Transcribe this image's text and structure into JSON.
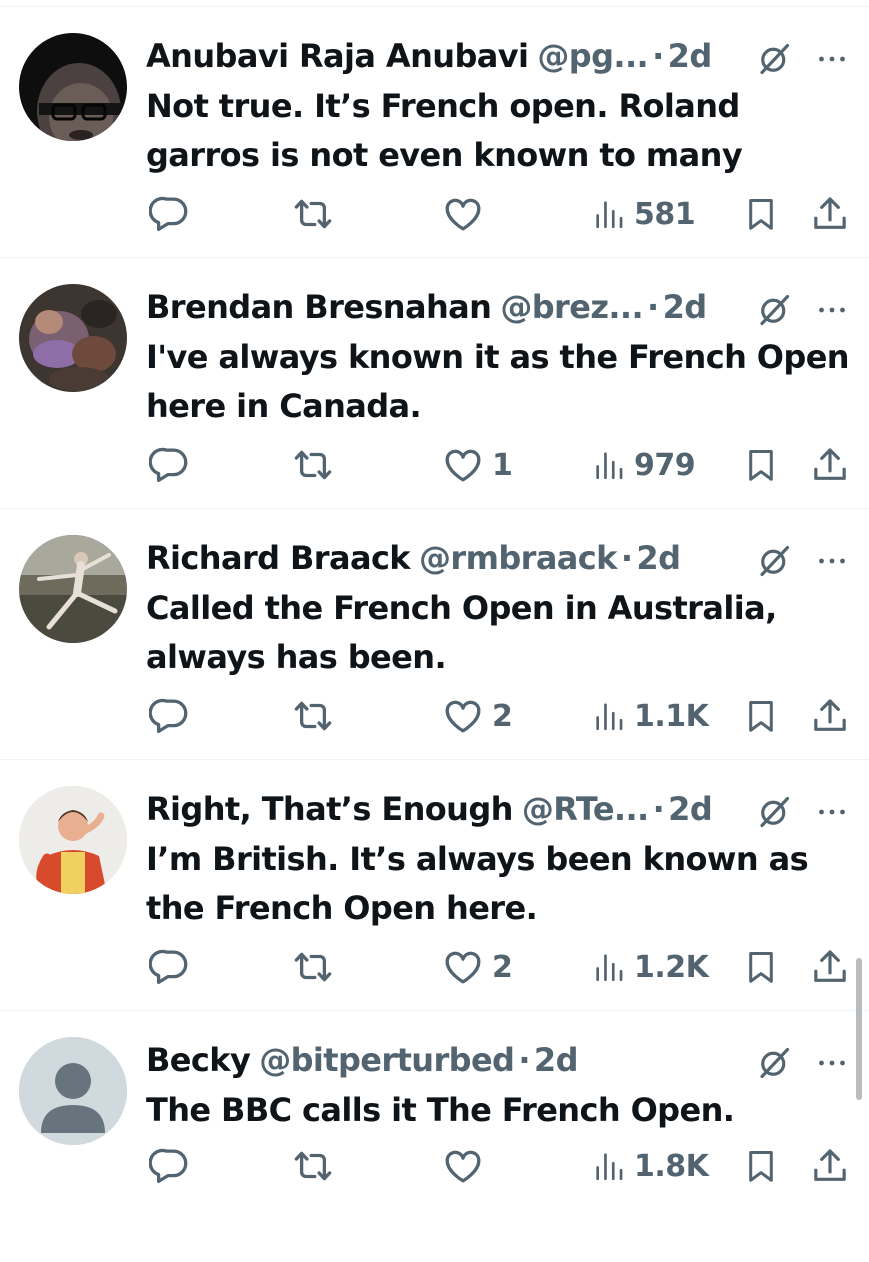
{
  "colors": {
    "text_primary": "#0f1419",
    "text_secondary": "#536471",
    "divider": "#eff3f4",
    "background": "#ffffff"
  },
  "icons": {
    "reply": "reply-icon",
    "retweet": "retweet-icon",
    "like": "heart-icon",
    "views": "views-icon",
    "bookmark": "bookmark-icon",
    "share": "share-icon",
    "grok": "grok-icon",
    "more": "more-icon"
  },
  "tweets": [
    {
      "display_name": "Anubavi Raja Anubavi",
      "handle": "@pg...",
      "separator": "·",
      "time": "2d",
      "text": "Not true. It’s French open. Roland garros is not even known to many",
      "reply_count": "",
      "retweet_count": "",
      "like_count": "",
      "views": "581",
      "avatar": "man-with-glasses-photo"
    },
    {
      "display_name": "Brendan Bresnahan",
      "handle": "@brez...",
      "separator": "·",
      "time": "2d",
      "text": "I've always known it as the French Open here in Canada.",
      "reply_count": "",
      "retweet_count": "",
      "like_count": "1",
      "views": "979",
      "avatar": "blurred-painting"
    },
    {
      "display_name": "Richard Braack",
      "handle": "@rmbraack",
      "separator": "·",
      "time": "2d",
      "text": "Called the French Open in Australia, always has been.",
      "reply_count": "",
      "retweet_count": "",
      "like_count": "2",
      "views": "1.1K",
      "avatar": "dancer-painting"
    },
    {
      "display_name": "Right, That’s Enough",
      "handle": "@RTe...",
      "separator": "·",
      "time": "2d",
      "text": "I’m British. It’s always been known as the French Open here.",
      "reply_count": "",
      "retweet_count": "",
      "like_count": "2",
      "views": "1.2K",
      "avatar": "man-red-shirt-illustration"
    },
    {
      "display_name": "Becky",
      "handle": "@bitperturbed",
      "separator": "·",
      "time": "2d",
      "text": "The BBC calls it The French Open.",
      "reply_count": "",
      "retweet_count": "",
      "like_count": "",
      "views": "1.8K",
      "avatar": "default-avatar"
    }
  ]
}
